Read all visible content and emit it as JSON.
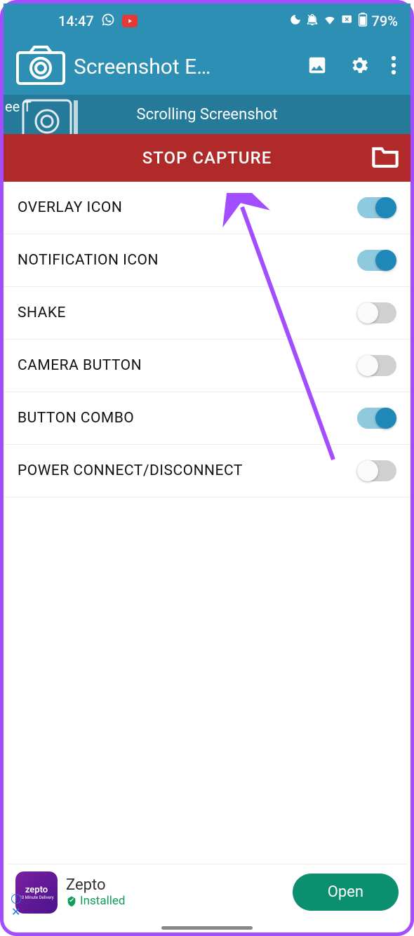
{
  "status": {
    "time": "14:47",
    "battery": "79%"
  },
  "appbar": {
    "title": "Screenshot E…"
  },
  "subbar": {
    "label": "Scrolling Screenshot",
    "overlay_text": "ee T"
  },
  "stopbar": {
    "label": "STOP CAPTURE"
  },
  "settings": [
    {
      "label": "OVERLAY ICON",
      "on": true
    },
    {
      "label": "NOTIFICATION ICON",
      "on": true
    },
    {
      "label": "SHAKE",
      "on": false
    },
    {
      "label": "CAMERA BUTTON",
      "on": false
    },
    {
      "label": "BUTTON COMBO",
      "on": true
    },
    {
      "label": "POWER CONNECT/DISCONNECT",
      "on": false
    }
  ],
  "ad": {
    "brand": "zepto",
    "brand_sub": "10 Minute Delivery",
    "title": "Zepto",
    "installed_label": "Installed",
    "button": "Open"
  }
}
